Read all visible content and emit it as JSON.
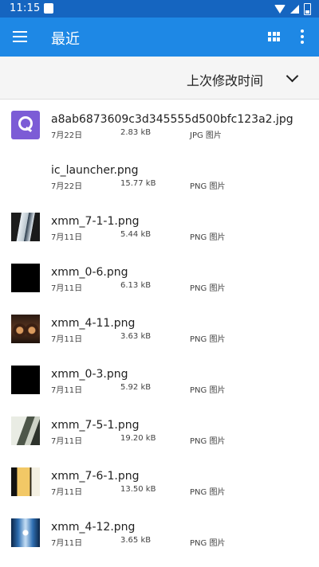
{
  "status_bar": {
    "time": "11:15",
    "icons": [
      "notification-box-icon",
      "wifi-icon",
      "signal-icon",
      "battery-icon"
    ]
  },
  "app_bar": {
    "title": "最近",
    "background": "#1e88e5",
    "icons": [
      "menu-icon",
      "grid-view-icon",
      "more-vert-icon"
    ]
  },
  "sort": {
    "label": "上次修改时间"
  },
  "files": [
    {
      "name": "a8ab6873609c3d345555d500bfc123a2.jpg",
      "date": "7月22日",
      "size": "2.83 kB",
      "type": "JPG 图片",
      "thumb": "purple-q-logo"
    },
    {
      "name": "ic_launcher.png",
      "date": "7月22日",
      "size": "15.77 kB",
      "type": "PNG 图片",
      "thumb": "blank-white"
    },
    {
      "name": "xmm_7-1-1.png",
      "date": "7月11日",
      "size": "5.44 kB",
      "type": "PNG 图片",
      "thumb": "coat-image"
    },
    {
      "name": "xmm_0-6.png",
      "date": "7月11日",
      "size": "6.13 kB",
      "type": "PNG 图片",
      "thumb": "black-image"
    },
    {
      "name": "xmm_4-11.png",
      "date": "7月11日",
      "size": "3.63 kB",
      "type": "PNG 图片",
      "thumb": "eyes-image"
    },
    {
      "name": "xmm_0-3.png",
      "date": "7月11日",
      "size": "5.92 kB",
      "type": "PNG 图片",
      "thumb": "black-image"
    },
    {
      "name": "xmm_7-5-1.png",
      "date": "7月11日",
      "size": "19.20 kB",
      "type": "PNG 图片",
      "thumb": "man-image"
    },
    {
      "name": "xmm_7-6-1.png",
      "date": "7月11日",
      "size": "13.50 kB",
      "type": "PNG 图片",
      "thumb": "face-image"
    },
    {
      "name": "xmm_4-12.png",
      "date": "7月11日",
      "size": "3.65 kB",
      "type": "PNG 图片",
      "thumb": "blue-image"
    }
  ]
}
